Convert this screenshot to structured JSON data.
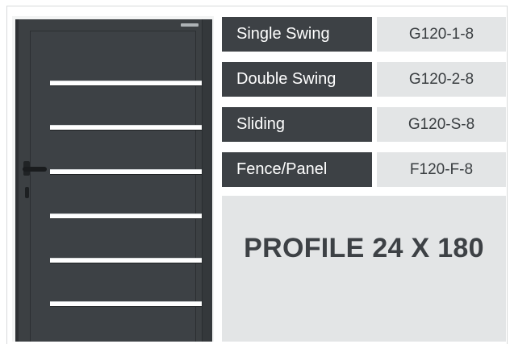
{
  "colors": {
    "dark_label_bg": "#3d4145",
    "light_cell_bg": "#e3e5e6",
    "gate_color": "#3c4043",
    "slat_color": "#ffffff"
  },
  "gate": {
    "slat_count": 6
  },
  "rows": [
    {
      "type": "Single Swing",
      "code": "G120-1-8"
    },
    {
      "type": "Double Swing",
      "code": "G120-2-8"
    },
    {
      "type": "Sliding",
      "code": "G120-S-8"
    },
    {
      "type": "Fence/Panel",
      "code": "F120-F-8"
    }
  ],
  "profile": {
    "label": "PROFILE 24 X 180"
  }
}
